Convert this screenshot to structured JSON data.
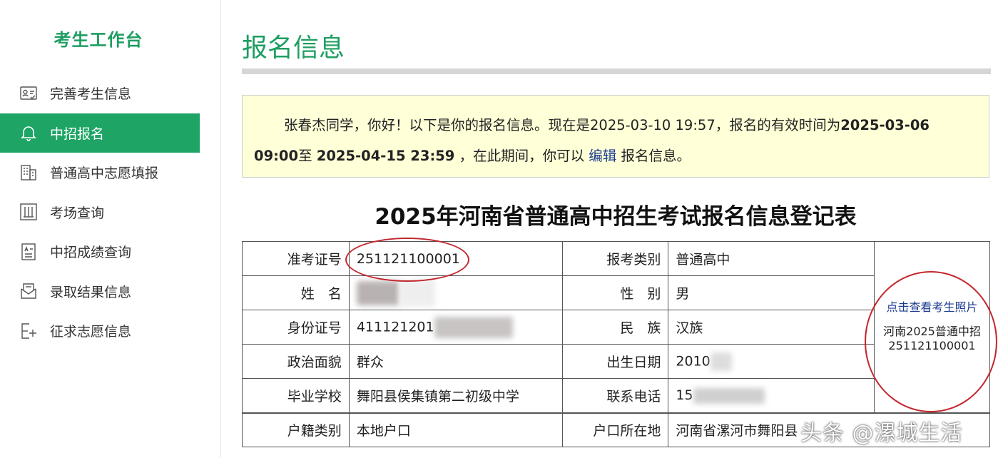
{
  "sidebar": {
    "title": "考生工作台",
    "items": [
      {
        "label": "完善考生信息",
        "icon": "id-card-icon",
        "active": false
      },
      {
        "label": "中招报名",
        "icon": "bell-icon",
        "active": true
      },
      {
        "label": "普通高中志愿填报",
        "icon": "building-icon",
        "active": false
      },
      {
        "label": "考场查询",
        "icon": "chart-icon",
        "active": false
      },
      {
        "label": "中招成绩查询",
        "icon": "score-doc-icon",
        "active": false
      },
      {
        "label": "录取结果信息",
        "icon": "envelope-icon",
        "active": false
      },
      {
        "label": "征求志愿信息",
        "icon": "add-doc-icon",
        "active": false
      }
    ]
  },
  "main": {
    "page_title": "报名信息",
    "notice": {
      "greeting": "张春杰同学，你好！以下是你的报名信息。现在是2025-03-10 19:57，报名的有效时间为",
      "start_time": "2025-03-06 09:00",
      "between": "至 ",
      "end_time": "2025-04-15 23:59",
      "mid": " ，在此期间，你可以 ",
      "edit_link": "编辑",
      "tail": " 报名信息。"
    },
    "form_title": "2025年河南省普通高中招生考试报名信息登记表",
    "form": {
      "exam_no_label": "准考证号",
      "exam_no": "251121100001",
      "category_label": "报考类别",
      "category": "普通高中",
      "name_label": "姓　名",
      "gender_label": "性　别",
      "gender": "男",
      "id_label": "身份证号",
      "id_prefix": "411121201",
      "ethnicity_label": "民　族",
      "ethnicity": "汉族",
      "political_label": "政治面貌",
      "political": "群众",
      "birth_label": "出生日期",
      "birth_prefix": "2010",
      "school_label": "毕业学校",
      "school": "舞阳县侯集镇第二初级中学",
      "phone_label": "联系电话",
      "phone_prefix": "15",
      "hukou_type_label": "户籍类别",
      "hukou_type": "本地户口",
      "hukou_loc_label": "户口所在地",
      "hukou_loc": "河南省漯河市舞阳县",
      "photo_link": "点击查看考生照片",
      "photo_text": "河南2025普通中招",
      "photo_no": "251121100001"
    },
    "watermark": "头条 @漯城生活"
  },
  "colors": {
    "accent": "#1ea566",
    "title_green": "#1e9e62",
    "notice_bg": "#ffffd8",
    "link": "#1a3a8e",
    "annotation_red": "#c2272d"
  }
}
